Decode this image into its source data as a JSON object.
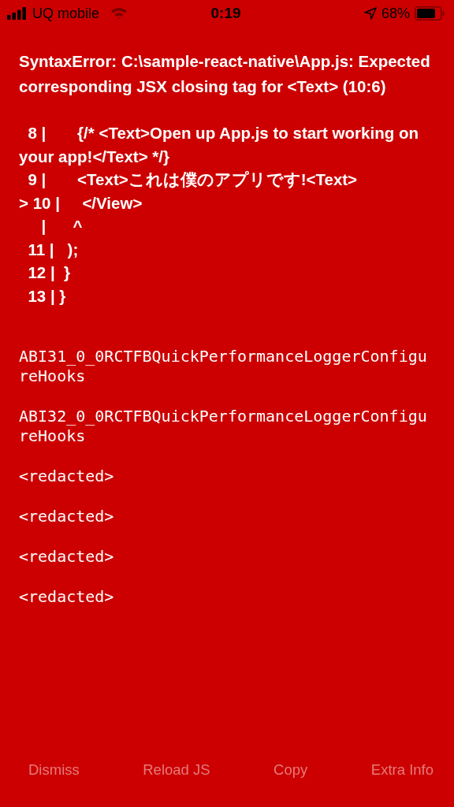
{
  "status_bar": {
    "carrier": "UQ mobile",
    "time": "0:19",
    "battery": "68%"
  },
  "error": {
    "message": "SyntaxError: C:\\sample-react-native\\App.js: Expected corresponding JSX closing tag for <Text> (10:6)",
    "code_lines": [
      "  8 |       {/* <Text>Open up App.js to start working on your app!</Text> */}",
      "  9 |       <Text>これは僕のアプリです!<Text>",
      "> 10 |     </View>",
      "     |      ^",
      "  11 |   );",
      "  12 |  }",
      "  13 | }"
    ]
  },
  "stack_frames": [
    "ABI31_0_0RCTFBQuickPerformanceLoggerConfigureHooks",
    "ABI32_0_0RCTFBQuickPerformanceLoggerConfigureHooks",
    "<redacted>",
    "<redacted>",
    "<redacted>",
    "<redacted>"
  ],
  "buttons": [
    "Dismiss",
    "Reload JS",
    "Copy",
    "Extra Info"
  ]
}
